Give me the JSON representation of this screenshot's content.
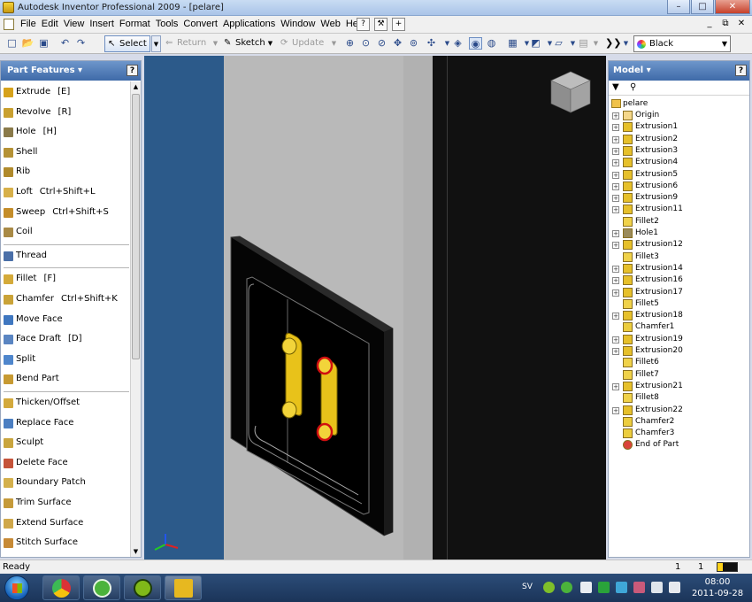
{
  "window": {
    "title": "Autodesk Inventor Professional 2009 - [pelare]",
    "minimize": "–",
    "maximize": "□",
    "close": "✕"
  },
  "menubar": {
    "items": [
      "File",
      "Edit",
      "View",
      "Insert",
      "Format",
      "Tools",
      "Convert",
      "Applications",
      "Window",
      "Web",
      "Help"
    ],
    "extra_icons": [
      "?",
      "⚒",
      "+"
    ],
    "mdi": [
      "_",
      "⧉",
      "✕"
    ]
  },
  "toolbar": {
    "select_label": "Select",
    "return_label": "Return",
    "sketch_label": "Sketch",
    "update_label": "Update",
    "color_value": "Black"
  },
  "part_features": {
    "header": "Part Features ▾",
    "help": "?",
    "items": [
      {
        "label": "Extrude",
        "shortcut": "[E]",
        "icon": "extrude-icon",
        "color": "#d6a21c"
      },
      {
        "label": "Revolve",
        "shortcut": "[R]",
        "icon": "revolve-icon",
        "color": "#c9a030"
      },
      {
        "label": "Hole",
        "shortcut": "[H]",
        "icon": "hole-icon",
        "color": "#8a7a4a"
      },
      {
        "label": "Shell",
        "shortcut": "",
        "icon": "shell-icon",
        "color": "#b59236"
      },
      {
        "label": "Rib",
        "shortcut": "",
        "icon": "rib-icon",
        "color": "#b08a2c"
      },
      {
        "label": "Loft",
        "shortcut": "Ctrl+Shift+L",
        "icon": "loft-icon",
        "color": "#d7b04a"
      },
      {
        "label": "Sweep",
        "shortcut": "Ctrl+Shift+S",
        "icon": "sweep-icon",
        "color": "#c48d2a"
      },
      {
        "label": "Coil",
        "shortcut": "",
        "icon": "coil-icon",
        "color": "#a98a46"
      },
      {
        "label": "Thread",
        "shortcut": "",
        "icon": "thread-icon",
        "color": "#4a6fa8"
      },
      {
        "label": "Fillet",
        "shortcut": "[F]",
        "icon": "fillet-icon",
        "color": "#d4aa3a"
      },
      {
        "label": "Chamfer",
        "shortcut": "Ctrl+Shift+K",
        "icon": "chamfer-icon",
        "color": "#caa338"
      },
      {
        "label": "Move Face",
        "shortcut": "",
        "icon": "move-face-icon",
        "color": "#3f77c0"
      },
      {
        "label": "Face Draft",
        "shortcut": "[D]",
        "icon": "face-draft-icon",
        "color": "#5a85c2"
      },
      {
        "label": "Split",
        "shortcut": "",
        "icon": "split-icon",
        "color": "#4f86cc"
      },
      {
        "label": "Bend Part",
        "shortcut": "",
        "icon": "bend-part-icon",
        "color": "#c79a32"
      },
      {
        "label": "Thicken/Offset",
        "shortcut": "",
        "icon": "thicken-icon",
        "color": "#d3a93c"
      },
      {
        "label": "Replace Face",
        "shortcut": "",
        "icon": "replace-face-icon",
        "color": "#4c7fc2"
      },
      {
        "label": "Sculpt",
        "shortcut": "",
        "icon": "sculpt-icon",
        "color": "#c9a53e"
      },
      {
        "label": "Delete Face",
        "shortcut": "",
        "icon": "delete-face-icon",
        "color": "#c5533a"
      },
      {
        "label": "Boundary Patch",
        "shortcut": "",
        "icon": "boundary-patch-icon",
        "color": "#d4b04c"
      },
      {
        "label": "Trim Surface",
        "shortcut": "",
        "icon": "trim-surface-icon",
        "color": "#c59a3a"
      },
      {
        "label": "Extend Surface",
        "shortcut": "",
        "icon": "extend-surface-icon",
        "color": "#cfa74a"
      },
      {
        "label": "Stitch Surface",
        "shortcut": "",
        "icon": "stitch-surface-icon",
        "color": "#c78a36"
      }
    ]
  },
  "model_browser": {
    "header": "Model ▾",
    "help": "?",
    "root": "pelare",
    "nodes": [
      {
        "label": "Origin",
        "expandable": true,
        "icon": "folder-icon"
      },
      {
        "label": "Extrusion1",
        "expandable": true,
        "icon": "extrusion-icon"
      },
      {
        "label": "Extrusion2",
        "expandable": true,
        "icon": "extrusion-icon"
      },
      {
        "label": "Extrusion3",
        "expandable": true,
        "icon": "extrusion-icon"
      },
      {
        "label": "Extrusion4",
        "expandable": true,
        "icon": "extrusion-icon"
      },
      {
        "label": "Extrusion5",
        "expandable": true,
        "icon": "extrusion-icon"
      },
      {
        "label": "Extrusion6",
        "expandable": true,
        "icon": "extrusion-icon"
      },
      {
        "label": "Extrusion9",
        "expandable": true,
        "icon": "extrusion-icon"
      },
      {
        "label": "Extrusion11",
        "expandable": true,
        "icon": "extrusion-icon"
      },
      {
        "label": "Fillet2",
        "expandable": false,
        "icon": "fillet-icon"
      },
      {
        "label": "Hole1",
        "expandable": true,
        "icon": "hole-icon"
      },
      {
        "label": "Extrusion12",
        "expandable": true,
        "icon": "extrusion-icon"
      },
      {
        "label": "Fillet3",
        "expandable": false,
        "icon": "fillet-icon"
      },
      {
        "label": "Extrusion14",
        "expandable": true,
        "icon": "extrusion-icon"
      },
      {
        "label": "Extrusion16",
        "expandable": true,
        "icon": "extrusion-icon"
      },
      {
        "label": "Extrusion17",
        "expandable": true,
        "icon": "extrusion-icon"
      },
      {
        "label": "Fillet5",
        "expandable": false,
        "icon": "fillet-icon"
      },
      {
        "label": "Extrusion18",
        "expandable": true,
        "icon": "extrusion-icon"
      },
      {
        "label": "Chamfer1",
        "expandable": false,
        "icon": "chamfer-icon"
      },
      {
        "label": "Extrusion19",
        "expandable": true,
        "icon": "extrusion-icon"
      },
      {
        "label": "Extrusion20",
        "expandable": true,
        "icon": "extrusion-icon"
      },
      {
        "label": "Fillet6",
        "expandable": false,
        "icon": "fillet-icon"
      },
      {
        "label": "Fillet7",
        "expandable": false,
        "icon": "fillet-icon"
      },
      {
        "label": "Extrusion21",
        "expandable": true,
        "icon": "extrusion-icon"
      },
      {
        "label": "Fillet8",
        "expandable": false,
        "icon": "fillet-icon"
      },
      {
        "label": "Extrusion22",
        "expandable": true,
        "icon": "extrusion-icon"
      },
      {
        "label": "Chamfer2",
        "expandable": false,
        "icon": "chamfer-icon"
      },
      {
        "label": "Chamfer3",
        "expandable": false,
        "icon": "chamfer-icon"
      },
      {
        "label": "End of Part",
        "expandable": false,
        "icon": "end-of-part-icon"
      }
    ]
  },
  "status": {
    "text": "Ready",
    "count1": "1",
    "count2": "1"
  },
  "taskbar": {
    "lang": "SV",
    "time": "08:00",
    "date": "2011-09-28"
  }
}
